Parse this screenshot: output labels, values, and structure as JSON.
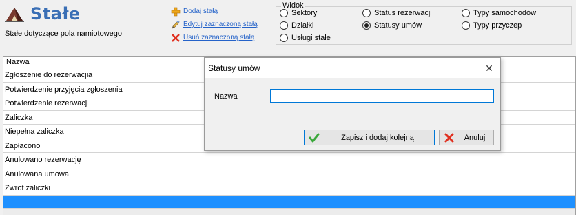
{
  "header": {
    "title": "Stałe",
    "subtitle": "Stałe dotyczące pola namiotowego"
  },
  "actions": {
    "add": "Dodaj stałą",
    "edit": "Edytuj zaznaczoną stałą",
    "remove": "Usuń zaznaczoną stałą"
  },
  "view": {
    "legend": "Widok",
    "options": [
      {
        "label": "Sektory",
        "checked": false
      },
      {
        "label": "Działki",
        "checked": false
      },
      {
        "label": "Usługi stałe",
        "checked": false
      },
      {
        "label": "Status rezerwacji",
        "checked": false
      },
      {
        "label": "Statusy umów",
        "checked": true
      },
      {
        "label": "Typy samochodów",
        "checked": false
      },
      {
        "label": "Typy przyczep",
        "checked": false
      }
    ]
  },
  "grid": {
    "column": "Nazwa",
    "rows": [
      "Zgłoszenie do rezerwacjia",
      "Potwierdzenie przyjęcia zgłoszenia",
      "Potwierdzenie rezerwacji",
      "Zaliczka",
      "Niepełna zaliczka",
      "Zapłacono",
      "Anulowano rezerwację",
      "Anulowana umowa",
      "Zwrot zaliczki"
    ]
  },
  "dialog": {
    "title": "Statusy umów",
    "close": "✕",
    "field_label": "Nazwa",
    "field_value": "",
    "save_label": "Zapisz i dodaj kolejną",
    "cancel_label": "Anuluj"
  },
  "colors": {
    "title": "#3a6fb5",
    "link": "#2563c9",
    "selection": "#1e90ff",
    "focus": "#0078d7"
  }
}
